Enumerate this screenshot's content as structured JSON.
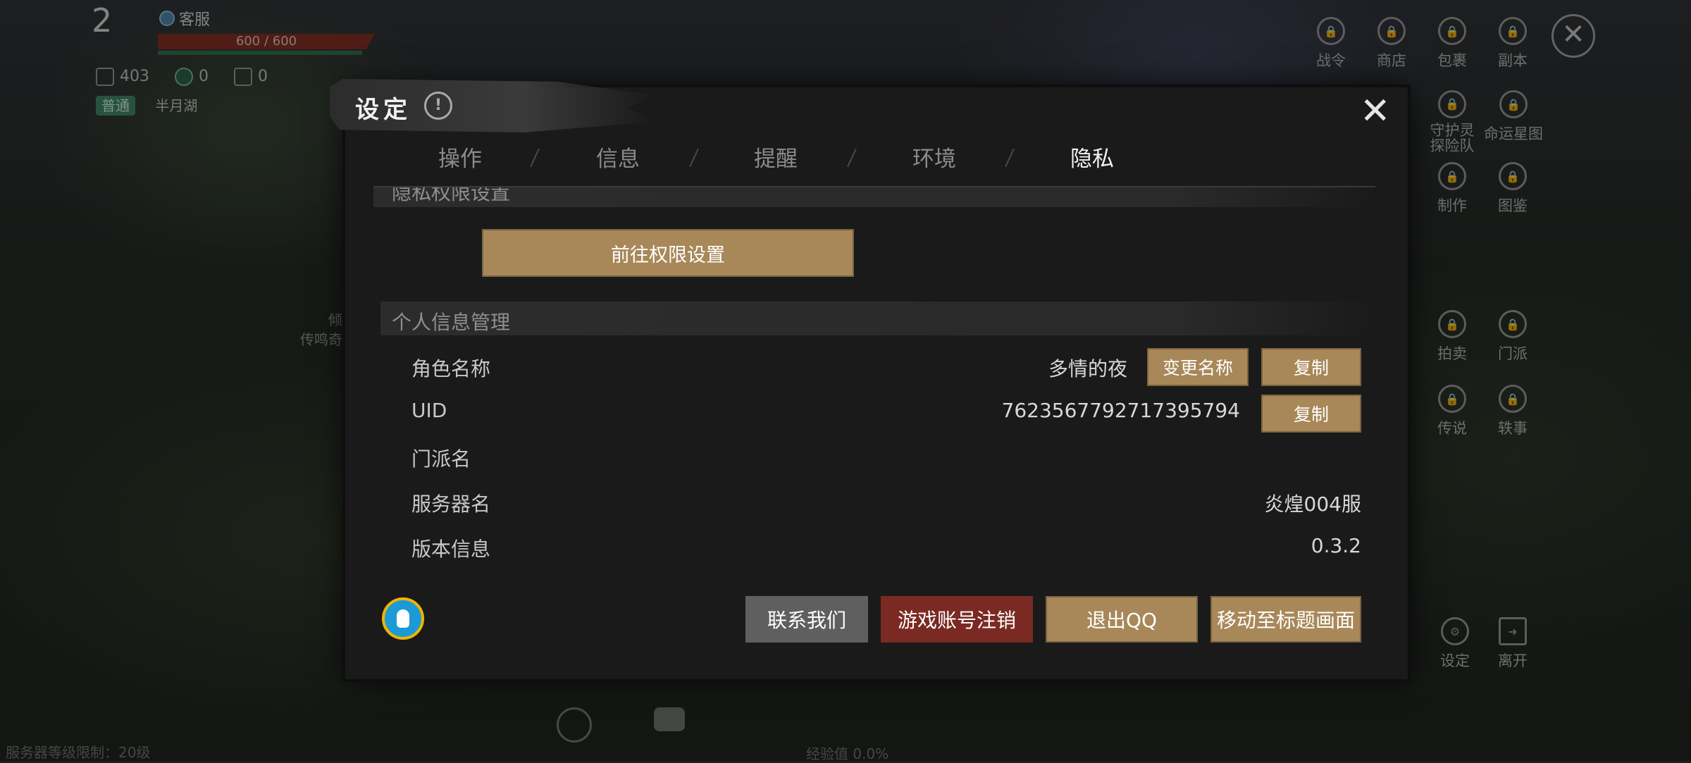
{
  "hud": {
    "level": "2",
    "customer_service": "客服",
    "hp": "600 / 600",
    "stat_power": "403",
    "stat_b": "0",
    "stat_c": "0",
    "mode": "普通",
    "zone": "半月湖",
    "side_text_1": "倾",
    "side_text_2": "传鸣奇"
  },
  "right_menu": {
    "items": [
      "战令",
      "商店",
      "包裹",
      "副本",
      "守护灵探险队",
      "命运星图",
      "制作",
      "图鉴",
      "拍卖",
      "门派",
      "传说",
      "轶事",
      "设定",
      "离开"
    ]
  },
  "bottom": {
    "server_limit": "服务器等级限制：20级",
    "exp": "经验值 0.0%"
  },
  "dialog": {
    "title": "设定",
    "info_glyph": "!",
    "close_glyph": "✕",
    "tabs": [
      "操作",
      "信息",
      "提醒",
      "环境",
      "隐私"
    ],
    "active_tab": "隐私",
    "privacy_section": "隐私权限设置",
    "goto_permission_button": "前往权限设置",
    "personal_section": "个人信息管理",
    "rows": {
      "role_name_label": "角色名称",
      "role_name_value": "多情的夜",
      "rename_button": "变更名称",
      "copy_button": "复制",
      "uid_label": "UID",
      "uid_value": "7623567792717395794",
      "guild_label": "门派名",
      "server_label": "服务器名",
      "server_value": "炎煌004服",
      "version_label": "版本信息",
      "version_value": "0.3.2"
    },
    "footer": {
      "contact": "联系我们",
      "cancel_account": "游戏账号注销",
      "logout_qq": "退出QQ",
      "to_title": "移动至标题画面"
    }
  },
  "colors": {
    "gold_button": "#a88859",
    "red_button": "#7a2a23",
    "gray_button": "#5f5f5f"
  }
}
